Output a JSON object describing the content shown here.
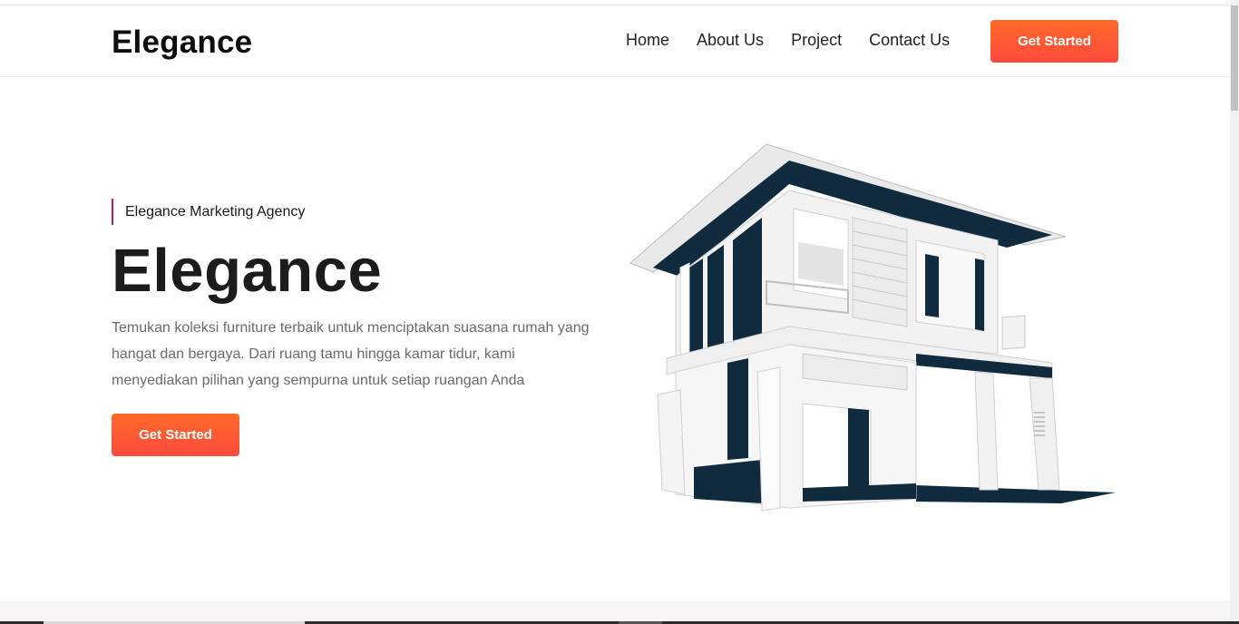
{
  "nav": {
    "brand": "Elegance",
    "links": [
      "Home",
      "About Us",
      "Project",
      "Contact Us"
    ],
    "cta_label": "Get Started"
  },
  "hero": {
    "tagline": "Elegance Marketing Agency",
    "title": "Elegance",
    "description": "Temukan koleksi furniture terbaik untuk menciptakan suasana rumah yang hangat dan bergaya. Dari ruang tamu hingga kamar tidur, kami menyediakan pilihan yang sempurna untuk setiap ruangan Anda",
    "cta_label": "Get Started"
  },
  "colors": {
    "accent_gradient_start": "#ff6a2a",
    "accent_gradient_end": "#ff4a3d",
    "tagline_bar": "#c2185b",
    "house_dark": "#0f2b3d"
  }
}
